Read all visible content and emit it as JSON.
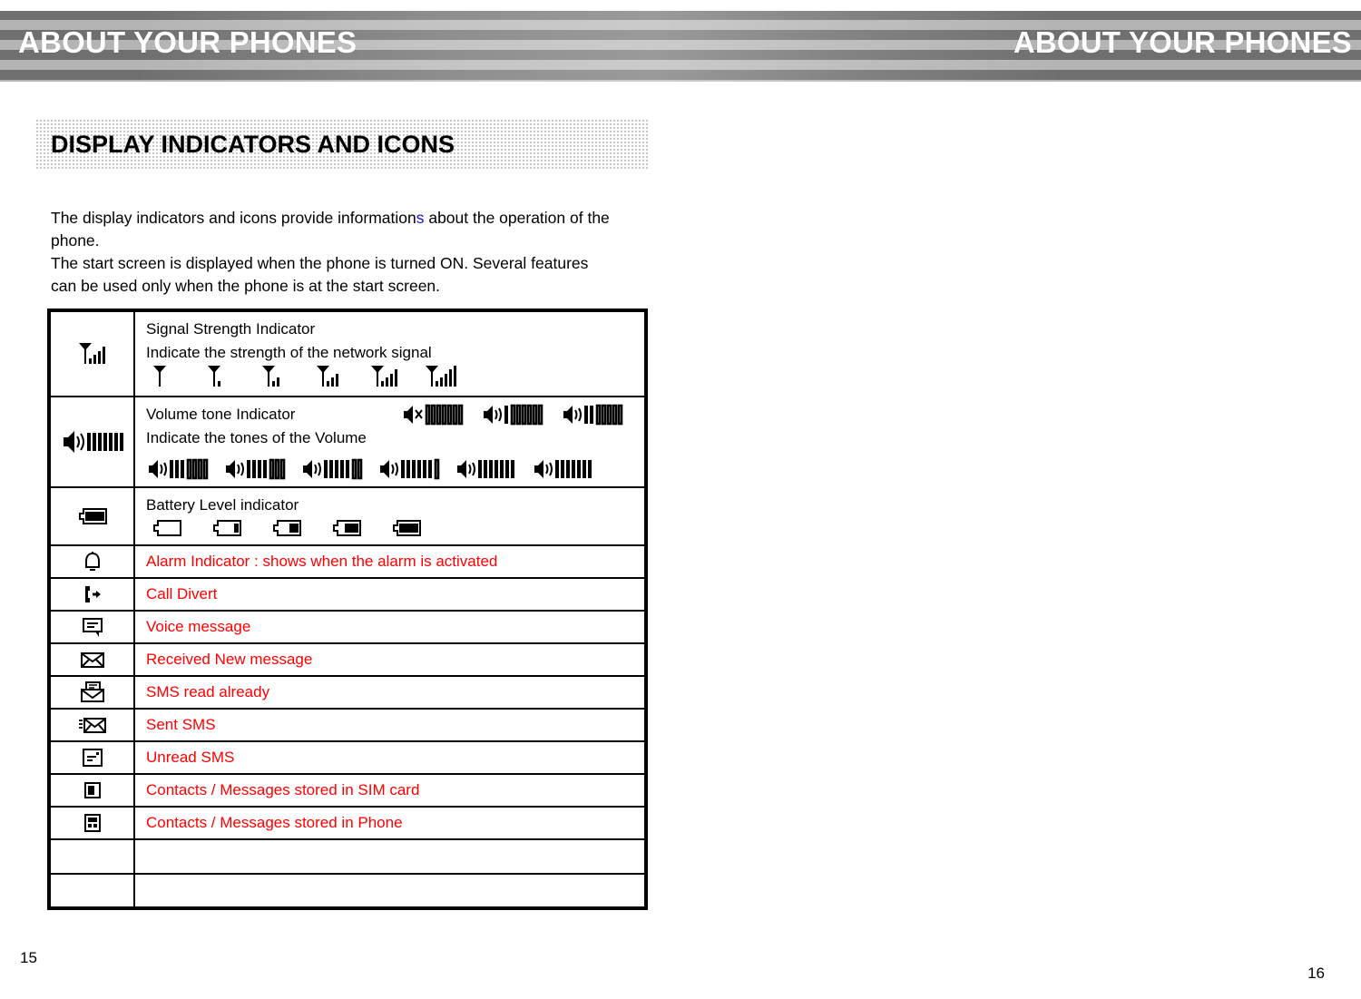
{
  "header": {
    "title_left": "ABOUT YOUR PHONES",
    "title_right": "ABOUT YOUR PHONES"
  },
  "section": {
    "heading": "DISPLAY INDICATORS AND ICONS"
  },
  "intro": {
    "line1_a": "The display indicators and icons provide information",
    "line1_hl": "s",
    "line1_b": " about the operation of the",
    "line2": "phone.",
    "line3": "The start screen is displayed when the phone is turned ON. Several features",
    "line4": "can be used only when the phone is at the start screen."
  },
  "table": {
    "rows": [
      {
        "icon": "signal-strength-icon",
        "title": "Signal Strength Indicator",
        "subtitle": "Indicate the strength of the network signal",
        "variants": "6 antenna icons with 0,1,2,3,4,5 signal bars",
        "color": "#000000"
      },
      {
        "icon": "volume-tone-icon",
        "title": "Volume tone Indicator",
        "subtitle": "Indicate the tones of the Volume",
        "variants": "9 speaker icons with 0 through 7 of 7 bars filled, first is muted",
        "color": "#000000"
      },
      {
        "icon": "battery-level-icon",
        "title": "Battery Level indicator",
        "subtitle": "",
        "variants": "5 battery icons with 0,1,2,3,4 of 4 segments filled",
        "color": "#000000"
      },
      {
        "icon": "alarm-bell-icon",
        "title": "Alarm Indicator : shows when the alarm is activated",
        "color": "#ff0000"
      },
      {
        "icon": "call-divert-icon",
        "title": "Call Divert",
        "color": "#ff0000"
      },
      {
        "icon": "voice-message-icon",
        "title": "Voice message",
        "color": "#ff0000"
      },
      {
        "icon": "new-message-icon",
        "title": "Received New message",
        "color": "#ff0000"
      },
      {
        "icon": "sms-read-icon",
        "title": "SMS read already",
        "color": "#ff0000"
      },
      {
        "icon": "sent-sms-icon",
        "title": "Sent SMS",
        "color": "#ff0000"
      },
      {
        "icon": "unread-sms-icon",
        "title": "Unread SMS",
        "color": "#ff0000"
      },
      {
        "icon": "sim-card-storage-icon",
        "title": "Contacts / Messages stored in SIM card",
        "color": "#ff0000"
      },
      {
        "icon": "phone-storage-icon",
        "title": "Contacts / Messages stored in Phone",
        "color": "#ff0000"
      },
      {
        "icon": "",
        "title": "",
        "color": "#ff0000"
      },
      {
        "icon": "",
        "title": "",
        "color": "#ff0000"
      }
    ]
  },
  "footer": {
    "page_left": "15",
    "page_right": "16"
  },
  "colors": {
    "red": "#ff0000",
    "blue_highlight": "#1010e0",
    "banner_dark": "#6f6f6f",
    "banner_light": "#b4b4b4",
    "heading_bg": "#e9e9e9"
  }
}
